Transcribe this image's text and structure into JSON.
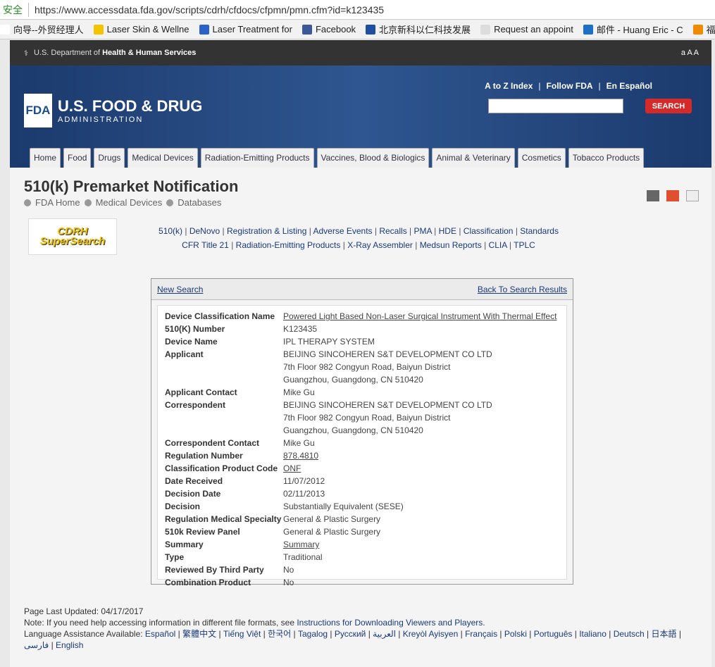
{
  "browser": {
    "security": "安全",
    "url": "https://www.accessdata.fda.gov/scripts/cdrh/cfdocs/cfpmn/pmn.cfm?id=k123435",
    "bookmarks": [
      {
        "label": "向导--外贸经理人",
        "color": "#fff"
      },
      {
        "label": "Laser Skin & Wellne",
        "color": "#f5c400"
      },
      {
        "label": "Laser Treatment for",
        "color": "#2a62c9"
      },
      {
        "label": "Facebook",
        "color": "#3b5998"
      },
      {
        "label": "北京新科以仁科技发展",
        "color": "#1f4fa0"
      },
      {
        "label": "Request an appoint",
        "color": "#ddd"
      },
      {
        "label": "邮件 - Huang Eric - C",
        "color": "#1e6fc6"
      },
      {
        "label": "福步外贸论",
        "color": "#f08a00"
      }
    ]
  },
  "hhs": {
    "prefix": "U.S. Department of",
    "bold": "Health & Human Services",
    "sizes": "a A A"
  },
  "header": {
    "logo_mark": "FDA",
    "logo_title": "U.S. FOOD & DRUG",
    "logo_sub": "ADMINISTRATION",
    "links": [
      "A to Z Index",
      "Follow FDA",
      "En Español"
    ],
    "search_button": "SEARCH",
    "search_value": ""
  },
  "nav": [
    "Home",
    "Food",
    "Drugs",
    "Medical Devices",
    "Radiation-Emitting Products",
    "Vaccines, Blood & Biologics",
    "Animal & Veterinary",
    "Cosmetics",
    "Tobacco Products"
  ],
  "page": {
    "title": "510(k) Premarket Notification",
    "breadcrumb": [
      "FDA Home",
      "Medical Devices",
      "Databases"
    ],
    "cdrh_logo": "CDRH SuperSearch",
    "links_row1": [
      "510(k)",
      "DeNovo",
      "Registration & Listing",
      "Adverse Events",
      "Recalls",
      "PMA",
      "HDE",
      "Classification",
      "Standards"
    ],
    "links_row2": [
      "CFR Title 21",
      "Radiation-Emitting Products",
      "X-Ray Assembler",
      "Medsun Reports",
      "CLIA",
      "TPLC"
    ]
  },
  "record": {
    "new_search": "New Search",
    "back": "Back To Search Results",
    "rows": [
      {
        "k": "Device Classification Name",
        "v": "Powered Light Based Non-Laser Surgical Instrument With Thermal Effect",
        "link": true
      },
      {
        "k": "510(K) Number",
        "v": "K123435"
      },
      {
        "k": "Device Name",
        "v": "IPL THERAPY SYSTEM"
      },
      {
        "k": "Applicant",
        "v": "BEIJING SINCOHEREN S&T DEVELOPMENT CO LTD\n7th Floor 982 Congyun Road, Baiyun District\nGuangzhou, Guangdong,  CN 510420"
      },
      {
        "k": "Applicant Contact",
        "v": "Mike Gu"
      },
      {
        "k": "Correspondent",
        "v": "BEIJING SINCOHEREN S&T DEVELOPMENT CO LTD\n7th Floor 982 Congyun Road, Baiyun District\nGuangzhou, Guangdong,  CN 510420"
      },
      {
        "k": "Correspondent Contact",
        "v": "Mike Gu"
      },
      {
        "k": "Regulation Number",
        "v": "878.4810",
        "link": true
      },
      {
        "k": "Classification Product Code",
        "v": "ONF",
        "link": true
      },
      {
        "k": "Date Received",
        "v": "11/07/2012"
      },
      {
        "k": "Decision Date",
        "v": "02/11/2013"
      },
      {
        "k": "Decision",
        "v": "Substantially Equivalent (SESE)"
      },
      {
        "k": "Regulation Medical Specialty",
        "v": "General & Plastic Surgery"
      },
      {
        "k": "510k Review Panel",
        "v": "General & Plastic Surgery"
      },
      {
        "k": "Summary",
        "v": "Summary",
        "link": true
      },
      {
        "k": "Type",
        "v": "Traditional"
      },
      {
        "k": "Reviewed By Third Party",
        "v": "No"
      },
      {
        "k": "Combination Product",
        "v": "No"
      }
    ]
  },
  "footer": {
    "updated": "Page Last Updated: 04/17/2017",
    "note": "Note: If you need help accessing information in different file formats, see",
    "note_link": "Instructions for Downloading Viewers and Players.",
    "lang_label": "Language Assistance Available:",
    "languages": [
      "Español",
      "繁體中文",
      "Tiếng Việt",
      "한국어",
      "Tagalog",
      "Русский",
      "العربية",
      "Kreyòl Ayisyen",
      "Français",
      "Polski",
      "Português",
      "Italiano",
      "Deutsch",
      "日本語",
      "فارسی",
      "English"
    ]
  }
}
